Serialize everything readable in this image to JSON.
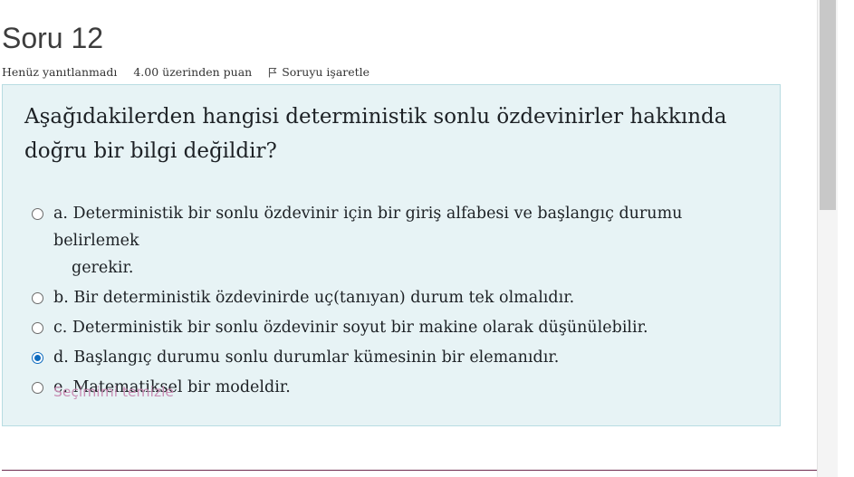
{
  "question": {
    "title": "Soru 12",
    "status": "Henüz yanıtlanmadı",
    "points": "4.00 üzerinden puan",
    "flag_label": "Soruyu işaretle",
    "text": "Aşağıdakilerden hangisi deterministik sonlu özdevinirler hakkında doğru bir bilgi değildir?",
    "answers": [
      {
        "label": "a. Deterministik bir sonlu özdevinir için bir giriş alfabesi ve başlangıç durumu belirlemek",
        "continuation": "gerekir.",
        "selected": false
      },
      {
        "label": "b. Bir deterministik özdevinirde uç(tanıyan) durum tek olmalıdır.",
        "selected": false
      },
      {
        "label": "c. Deterministik bir sonlu özdevinir soyut bir makine olarak düşünülebilir.",
        "selected": false
      },
      {
        "label": "d. Başlangıç durumu sonlu durumlar kümesinin bir elemanıdır.",
        "selected": true
      },
      {
        "label": "e. Matematiksel bir modeldir.",
        "selected": false
      }
    ],
    "clear_label": "Seçimimi temizle"
  },
  "colors": {
    "question_bg": "#e7f3f5",
    "radio_selected": "#0f6cbf",
    "clear_link": "#c98fb5",
    "divider": "#6e2a4f"
  },
  "icons": {
    "flag": "flag-icon"
  }
}
